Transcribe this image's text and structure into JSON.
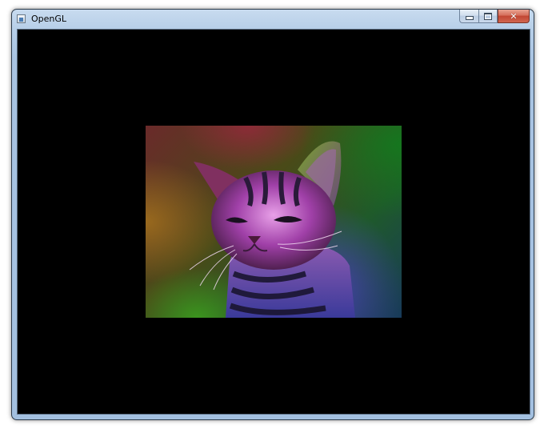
{
  "window": {
    "title": "OpenGL",
    "icon": "app-window-icon",
    "buttons": {
      "minimize_icon": "minimize-icon",
      "maximize_icon": "maximize-icon",
      "close_icon": "close-icon",
      "close_glyph": "✕"
    }
  },
  "viewport": {
    "background": "#000000",
    "texture_subject": "kitten-photo-texture"
  }
}
